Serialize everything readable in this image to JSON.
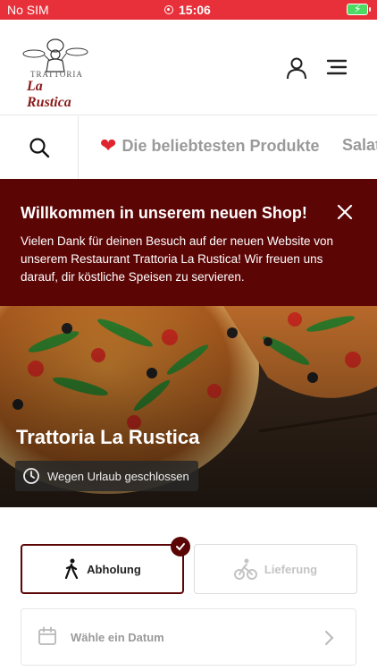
{
  "status_bar": {
    "carrier": "No SIM",
    "time": "15:06"
  },
  "header": {
    "logo_line1": "TRATTORIA",
    "logo_line2": "La Rustica"
  },
  "categories": [
    {
      "label": "Die beliebtesten Produkte",
      "icon": "heart-icon"
    },
    {
      "label": "Salat"
    }
  ],
  "welcome": {
    "title": "Willkommen in unserem neuen Shop!",
    "text": "Vielen Dank für deinen Besuch auf der neuen Website von unserem Restaurant Trattoria La Rustica! Wir freuen uns darauf, dir köstliche Speisen zu servieren."
  },
  "hero": {
    "restaurant_name": "Trattoria La Rustica",
    "status": "Wegen Urlaub geschlossen"
  },
  "order_mode": {
    "options": [
      {
        "label": "Abholung",
        "icon": "walking-icon",
        "selected": true
      },
      {
        "label": "Lieferung",
        "icon": "bike-icon",
        "selected": false
      }
    ]
  },
  "date_picker": {
    "label": "Wähle ein Datum"
  },
  "colors": {
    "accent": "#5c0505",
    "status_bar": "#e8303a",
    "heart": "#e0242f"
  }
}
